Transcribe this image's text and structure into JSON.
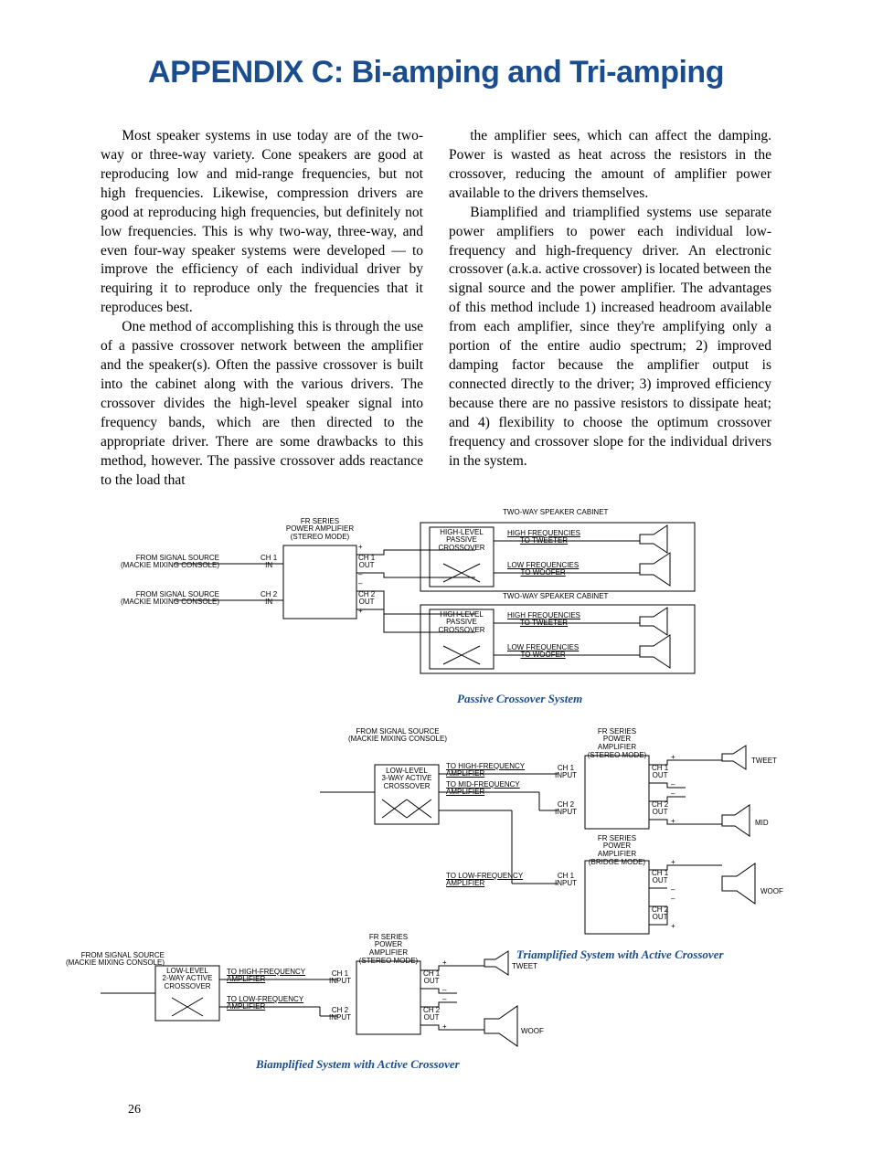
{
  "title": "APPENDIX C: Bi-amping and Tri-amping",
  "col1_p1": "Most speaker systems in use today are of the two-way or three-way variety. Cone speakers are good at reproducing low and mid-range frequencies, but not high frequencies. Likewise, compression drivers are good at reproducing high frequencies, but definitely not low frequencies. This is why two-way, three-way, and even four-way speaker systems were developed — to improve the efficiency of each individual driver by requiring it to reproduce only the frequencies that it reproduces best.",
  "col1_p2": "One method of accomplishing this is through the use of a passive crossover network between the amplifier and the speaker(s). Often the passive crossover is built into the cabinet along with the various drivers. The crossover divides the high-level speaker signal into frequency bands, which are then directed to the appropriate driver. There are some drawbacks to this method, however. The passive crossover adds reactance to the load that",
  "col2_p1": "the amplifier sees, which can affect the damping. Power is wasted as heat across the resistors in the crossover, reducing the amount of amplifier power available to the drivers themselves.",
  "col2_p2": "Biamplified and triamplified systems use separate power amplifiers to power each individual low-frequency and high-frequency driver. An electronic crossover (a.k.a. active crossover) is located between the signal source and the power amplifier. The advantages of this method include 1) increased headroom available from each amplifier, since they're amplifying only a portion of the entire audio spectrum; 2) improved damping factor because the amplifier output is connected directly to the driver; 3) improved efficiency because there are no passive resistors to dissipate heat; and 4) flexibility to choose the optimum crossover frequency and crossover slope for the individual drivers in the system.",
  "d": {
    "two_way_cab": "TWO-WAY SPEAKER CABINET",
    "fr_amp": "FR SERIES\nPOWER AMPLIFIER\n(STEREO MODE)",
    "fr_amp_bridge": "FR SERIES\nPOWER AMPLIFIER\n(BRIDGE MODE)",
    "from_source": "FROM SIGNAL SOURCE\n(MACKIE MIXING CONSOLE)",
    "hi_pass_xover": "HIGH-LEVEL\nPASSIVE\nCROSSOVER",
    "lo_3way_xover": "LOW-LEVEL\n3-WAY ACTIVE\nCROSSOVER",
    "lo_2way_xover": "LOW-LEVEL\n2-WAY ACTIVE\nCROSSOVER",
    "hi_to_tweet": "HIGH FREQUENCIES\nTO TWEETER",
    "lo_to_woof": "LOW FREQUENCIES\nTO WOOFER",
    "to_hi_amp": "TO HIGH-FREQUENCY\nAMPLIFIER",
    "to_mid_amp": "TO MID-FREQUENCY\nAMPLIFIER",
    "to_lo_amp": "TO LOW-FREQUENCY\nAMPLIFIER",
    "ch1_in": "CH 1\nIN",
    "ch2_in": "CH 2\nIN",
    "ch1_out": "CH 1\nOUT",
    "ch2_out": "CH 2\nOUT",
    "ch1_input": "CH 1\nINPUT",
    "ch2_input": "CH 2\nINPUT",
    "tweet": "TWEET",
    "mid": "MID",
    "woof": "WOOF"
  },
  "caption_passive": "Passive Crossover System",
  "caption_biamp": "Biamplified System with Active Crossover",
  "caption_triamp": "Triamplified System with Active Crossover",
  "page_number": "26"
}
